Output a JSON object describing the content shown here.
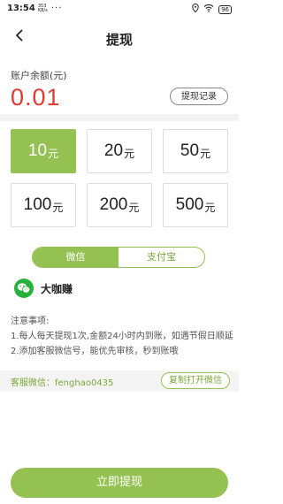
{
  "status_bar": {
    "time": "13:54",
    "network_speed": "353 KB/s",
    "dots": "···",
    "battery": "96"
  },
  "header": {
    "title": "提现"
  },
  "balance": {
    "label": "账户余额(元)",
    "value": "0.01",
    "value_color": "#e33a2f",
    "record_button": "提现记录"
  },
  "amounts": [
    {
      "num": "10",
      "unit": "元",
      "selected": true
    },
    {
      "num": "20",
      "unit": "元",
      "selected": false
    },
    {
      "num": "50",
      "unit": "元",
      "selected": false
    },
    {
      "num": "100",
      "unit": "元",
      "selected": false
    },
    {
      "num": "200",
      "unit": "元",
      "selected": false
    },
    {
      "num": "500",
      "unit": "元",
      "selected": false
    }
  ],
  "payment_tabs": {
    "items": [
      "微信",
      "支付宝"
    ],
    "active_index": 0
  },
  "account": {
    "icon": "wechat-icon",
    "name": "大咖赚"
  },
  "notes": {
    "title": "注意事项:",
    "lines": [
      "1.每人每天提现1次,金额24小时内到账，如遇节假日顺延",
      "2.添加客服微信号，能优先审核，秒到账哦"
    ]
  },
  "service": {
    "text": "客服微信：fenghao0435",
    "copy_button": "复制打开微信"
  },
  "submit": {
    "label": "立即提现"
  },
  "colors": {
    "accent": "#95c052",
    "balance_red": "#e33a2f"
  }
}
